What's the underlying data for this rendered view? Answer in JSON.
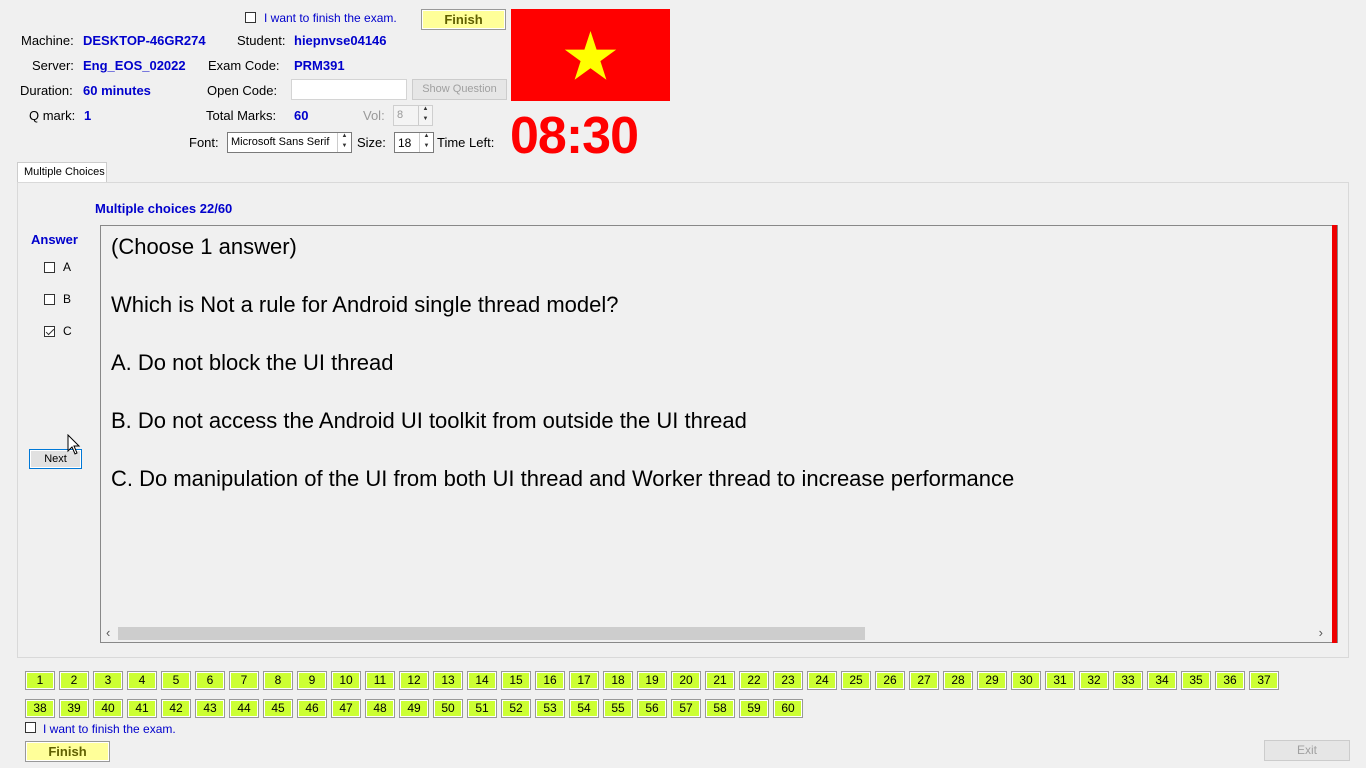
{
  "header": {
    "finish_top_label": "I want to finish the exam.",
    "finish_top_button": "Finish",
    "machine_label": "Machine:",
    "machine_value": "DESKTOP-46GR274",
    "student_label": "Student:",
    "student_value": "hiepnvse04146",
    "server_label": "Server:",
    "server_value": "Eng_EOS_02022",
    "exam_code_label": "Exam Code:",
    "exam_code_value": "PRM391",
    "duration_label": "Duration:",
    "duration_value": "60 minutes",
    "open_code_label": "Open Code:",
    "open_code_value": "",
    "show_question_button": "Show Question",
    "q_mark_label": "Q mark:",
    "q_mark_value": "1",
    "total_marks_label": "Total Marks:",
    "total_marks_value": "60",
    "vol_label": "Vol:",
    "vol_value": "8",
    "font_label": "Font:",
    "font_value": "Microsoft Sans Serif",
    "size_label": "Size:",
    "size_value": "18",
    "time_left_label": "Time Left:",
    "time_left_value": "08:30",
    "flag_colors": {
      "background": "#ff0000",
      "star": "#ffff00"
    }
  },
  "tab": {
    "label": "Multiple Choices"
  },
  "question": {
    "progress": "Multiple choices 22/60",
    "answer_label": "Answer",
    "options": [
      {
        "letter": "A",
        "checked": false
      },
      {
        "letter": "B",
        "checked": false
      },
      {
        "letter": "C",
        "checked": true
      }
    ],
    "next_button": "Next",
    "lines": [
      "(Choose 1 answer)",
      "Which is Not a rule for Android single thread model?",
      "A.  Do not block the UI thread",
      "B.  Do not access the Android UI toolkit from outside the UI thread",
      "C.  Do manipulation of the UI from both UI thread and Worker thread to increase performance"
    ]
  },
  "question_numbers": [
    "1",
    "2",
    "3",
    "4",
    "5",
    "6",
    "7",
    "8",
    "9",
    "10",
    "11",
    "12",
    "13",
    "14",
    "15",
    "16",
    "17",
    "18",
    "19",
    "20",
    "21",
    "22",
    "23",
    "24",
    "25",
    "26",
    "27",
    "28",
    "29",
    "30",
    "31",
    "32",
    "33",
    "34",
    "35",
    "36",
    "37",
    "38",
    "39",
    "40",
    "41",
    "42",
    "43",
    "44",
    "45",
    "46",
    "47",
    "48",
    "49",
    "50",
    "51",
    "52",
    "53",
    "54",
    "55",
    "56",
    "57",
    "58",
    "59",
    "60"
  ],
  "footer": {
    "finish_bottom_label": "I want to finish the exam.",
    "finish_bottom_button": "Finish",
    "exit_button": "Exit"
  },
  "colors": {
    "value_text": "#0000cc",
    "timer": "#ff0000",
    "question_button": "#ccff33",
    "finish_button": "#ffff99"
  }
}
